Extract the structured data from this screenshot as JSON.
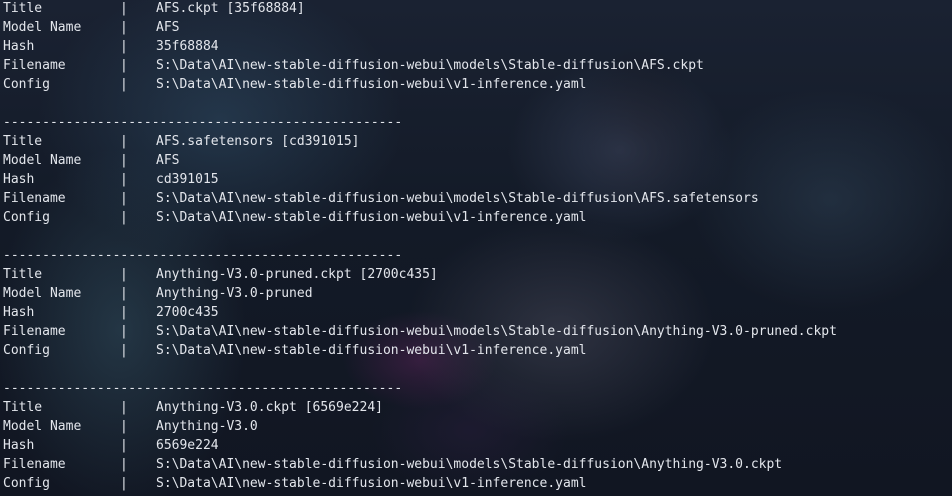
{
  "separator": "|",
  "divider_line": "---------------------------------------------------",
  "labels": {
    "title": "Title",
    "model_name": "Model Name",
    "hash": "Hash",
    "filename": "Filename",
    "config": "Config"
  },
  "models": [
    {
      "title": "AFS.ckpt [35f68884]",
      "model_name": "AFS",
      "hash": "35f68884",
      "filename": "S:\\Data\\AI\\new-stable-diffusion-webui\\models\\Stable-diffusion\\AFS.ckpt",
      "config": "S:\\Data\\AI\\new-stable-diffusion-webui\\v1-inference.yaml"
    },
    {
      "title": "AFS.safetensors [cd391015]",
      "model_name": "AFS",
      "hash": "cd391015",
      "filename": "S:\\Data\\AI\\new-stable-diffusion-webui\\models\\Stable-diffusion\\AFS.safetensors",
      "config": "S:\\Data\\AI\\new-stable-diffusion-webui\\v1-inference.yaml"
    },
    {
      "title": "Anything-V3.0-pruned.ckpt [2700c435]",
      "model_name": "Anything-V3.0-pruned",
      "hash": "2700c435",
      "filename": "S:\\Data\\AI\\new-stable-diffusion-webui\\models\\Stable-diffusion\\Anything-V3.0-pruned.ckpt",
      "config": "S:\\Data\\AI\\new-stable-diffusion-webui\\v1-inference.yaml"
    },
    {
      "title": "Anything-V3.0.ckpt [6569e224]",
      "model_name": "Anything-V3.0",
      "hash": "6569e224",
      "filename": "S:\\Data\\AI\\new-stable-diffusion-webui\\models\\Stable-diffusion\\Anything-V3.0.ckpt",
      "config": "S:\\Data\\AI\\new-stable-diffusion-webui\\v1-inference.yaml"
    }
  ]
}
